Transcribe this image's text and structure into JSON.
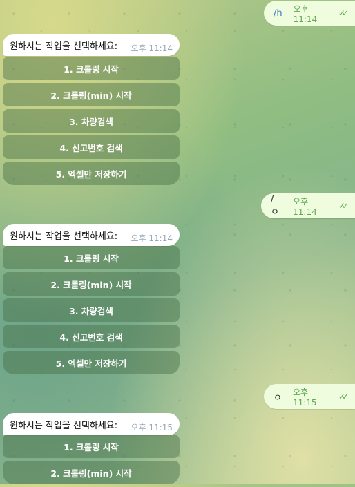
{
  "messages": [
    {
      "text": "/h",
      "time": "오후 11:14"
    },
    {
      "text": "/ㅇ",
      "time": "오후 11:14"
    },
    {
      "text": "ㅇ",
      "time": "오후 11:15"
    }
  ],
  "prompts": [
    {
      "text": "원하시는 작업을 선택하세요:",
      "time": "오후 11:14"
    },
    {
      "text": "원하시는 작업을 선택하세요:",
      "time": "오후 11:14"
    },
    {
      "text": "원하시는 작업을 선택하세요:",
      "time": "오후 11:15"
    }
  ],
  "keyboard_options": [
    "1. 크롤링 시작",
    "2. 크롤링(min) 시작",
    "3. 차량검색",
    "4. 신고번호 검색",
    "5. 엑셀만 저장하기"
  ],
  "read_receipt_icon": "double-check-icon"
}
